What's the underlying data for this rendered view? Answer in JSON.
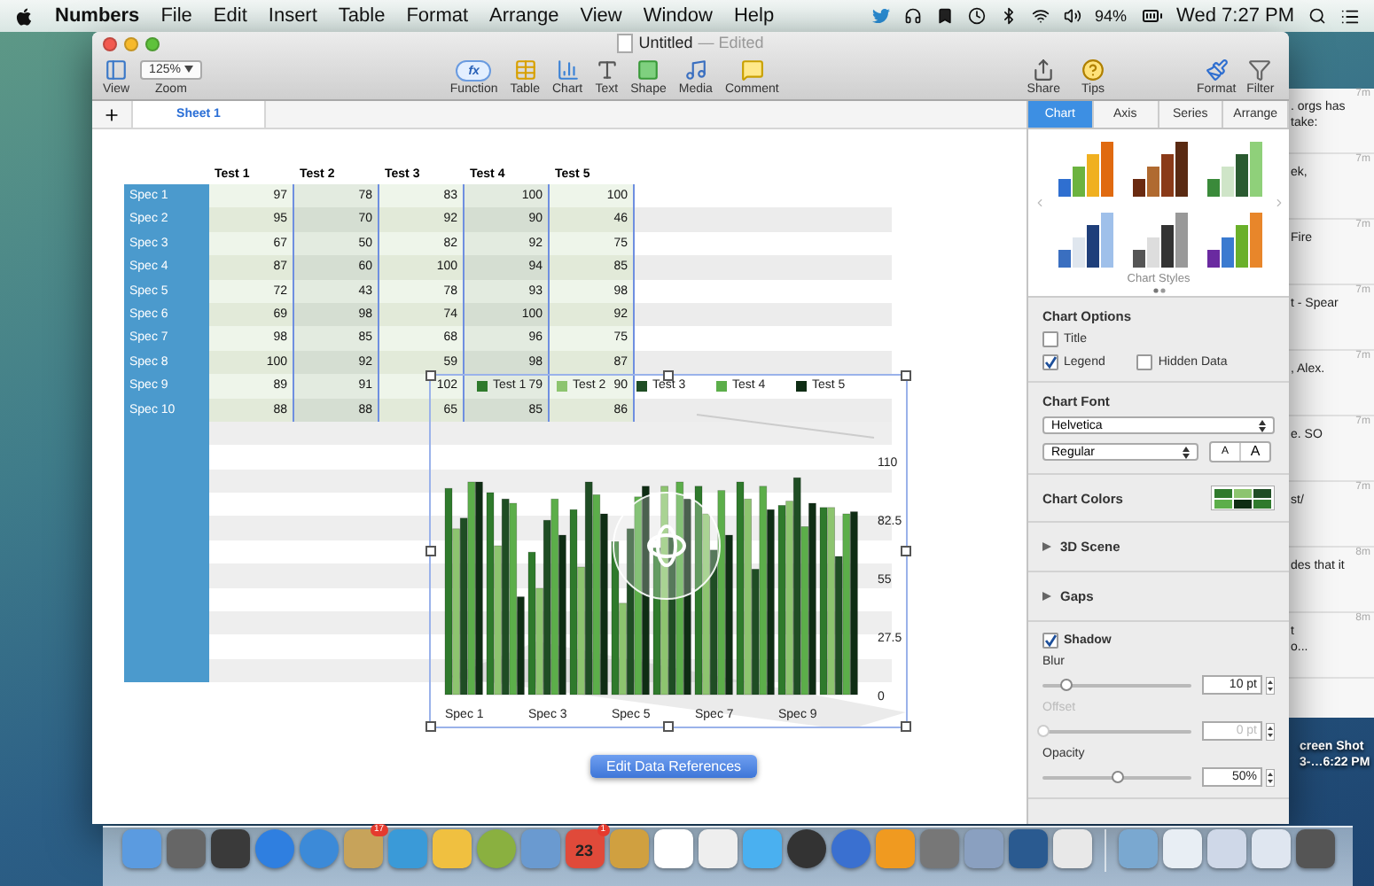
{
  "menu_bar": {
    "app_name": "Numbers",
    "menus": [
      "File",
      "Edit",
      "Insert",
      "Table",
      "Format",
      "Arrange",
      "View",
      "Window",
      "Help"
    ],
    "battery": "94%",
    "clock": "Wed 7:27 PM"
  },
  "window": {
    "title": "Untitled",
    "title_status": "— Edited"
  },
  "toolbar": {
    "view": "View",
    "zoom_value": "125%",
    "zoom_label": "Zoom",
    "insert": [
      {
        "kind": "function",
        "label": "Function",
        "glyph": "fx"
      },
      {
        "kind": "table",
        "label": "Table"
      },
      {
        "kind": "chart",
        "label": "Chart"
      },
      {
        "kind": "text",
        "label": "Text"
      },
      {
        "kind": "shape",
        "label": "Shape"
      },
      {
        "kind": "media",
        "label": "Media"
      },
      {
        "kind": "comment",
        "label": "Comment"
      }
    ],
    "share": [
      {
        "kind": "share",
        "label": "Share"
      },
      {
        "kind": "tips",
        "label": "Tips"
      }
    ],
    "right": [
      {
        "kind": "format",
        "label": "Format"
      },
      {
        "kind": "filter",
        "label": "Filter"
      }
    ]
  },
  "sheets": [
    {
      "label": "Sheet 1",
      "selected": true
    }
  ],
  "table": {
    "columns": [
      "Test 1",
      "Test 2",
      "Test 3",
      "Test 4",
      "Test 5"
    ],
    "rows": [
      {
        "label": "Spec 1",
        "values": [
          "97",
          "78",
          "83",
          "100",
          "100"
        ]
      },
      {
        "label": "Spec 2",
        "values": [
          "95",
          "70",
          "92",
          "90",
          "46"
        ]
      },
      {
        "label": "Spec 3",
        "values": [
          "67",
          "50",
          "82",
          "92",
          "75"
        ]
      },
      {
        "label": "Spec 4",
        "values": [
          "87",
          "60",
          "100",
          "94",
          "85"
        ]
      },
      {
        "label": "Spec 5",
        "values": [
          "72",
          "43",
          "78",
          "93",
          "98"
        ]
      },
      {
        "label": "Spec 6",
        "values": [
          "69",
          "98",
          "74",
          "100",
          "92"
        ]
      },
      {
        "label": "Spec 7",
        "values": [
          "98",
          "85",
          "68",
          "96",
          "75"
        ]
      },
      {
        "label": "Spec 8",
        "values": [
          "100",
          "92",
          "59",
          "98",
          "87"
        ]
      },
      {
        "label": "Spec 9",
        "values": [
          "89",
          "91",
          "102",
          "79",
          "90"
        ]
      },
      {
        "label": "Spec 10",
        "values": [
          "88",
          "88",
          "65",
          "85",
          "86"
        ]
      }
    ]
  },
  "chart": {
    "chart_data": {
      "type": "bar",
      "categories": [
        "Spec 1",
        null,
        "Spec 3",
        null,
        "Spec 5",
        null,
        "Spec 7",
        null,
        "Spec 9",
        null
      ],
      "series": [
        {
          "name": "Test 1",
          "color": "#2f7a2c",
          "values": [
            97,
            95,
            67,
            87,
            72,
            69,
            98,
            100,
            89,
            88
          ]
        },
        {
          "name": "Test 2",
          "color": "#8dc46f",
          "values": [
            78,
            70,
            50,
            60,
            43,
            98,
            85,
            92,
            91,
            88
          ]
        },
        {
          "name": "Test 3",
          "color": "#1f4d24",
          "values": [
            83,
            92,
            82,
            100,
            78,
            74,
            68,
            59,
            102,
            65
          ]
        },
        {
          "name": "Test 4",
          "color": "#5cae4a",
          "values": [
            100,
            90,
            92,
            94,
            93,
            100,
            96,
            98,
            79,
            85
          ]
        },
        {
          "name": "Test 5",
          "color": "#0f2d14",
          "values": [
            100,
            46,
            75,
            85,
            98,
            92,
            75,
            87,
            90,
            86
          ]
        }
      ],
      "ylim": [
        0,
        110
      ],
      "yticks": [
        {
          "value": 0,
          "label": "0"
        },
        {
          "value": 27.5,
          "label": "27.5"
        },
        {
          "value": 55,
          "label": "55"
        },
        {
          "value": 82.5,
          "label": "82.5"
        },
        {
          "value": 110,
          "label": "110"
        }
      ]
    }
  },
  "edit_button": "Edit Data References",
  "inspector": {
    "tabs": [
      {
        "label": "Chart",
        "selected": true
      },
      {
        "label": "Axis",
        "selected": false
      },
      {
        "label": "Series",
        "selected": false
      },
      {
        "label": "Arrange",
        "selected": false
      }
    ],
    "styles_caption": "Chart Styles",
    "chart_options": {
      "heading": "Chart Options",
      "options": [
        {
          "label": "Title",
          "checked": false
        },
        {
          "label": "Legend",
          "checked": true
        },
        {
          "label": "Hidden Data",
          "checked": false
        }
      ]
    },
    "chart_font": {
      "heading": "Chart Font",
      "family": "Helvetica",
      "style": "Regular",
      "size_buttons": [
        "A",
        "A"
      ]
    },
    "chart_colors": {
      "heading": "Chart Colors"
    },
    "disclosures": [
      {
        "label": "3D Scene",
        "expanded": false
      },
      {
        "label": "Gaps",
        "expanded": false
      }
    ],
    "shadow": {
      "label": "Shadow",
      "checked": true,
      "controls": [
        {
          "label": "Blur",
          "level": 0.15,
          "value": "10 pt",
          "disabled": false
        },
        {
          "label": "Offset",
          "level": 0,
          "value": "0 pt",
          "disabled": true
        },
        {
          "label": "Opacity",
          "level": 0.5,
          "value": "50%",
          "disabled": false
        }
      ]
    }
  },
  "background_window": {
    "items": [
      {
        "time": "7m",
        "lines": [
          ". orgs has",
          "take:"
        ]
      },
      {
        "time": "7m",
        "lines": [
          "ek,"
        ]
      },
      {
        "time": "7m",
        "lines": [
          "Fire"
        ]
      },
      {
        "time": "7m",
        "lines": [
          "t - Spear"
        ]
      },
      {
        "time": "7m",
        "lines": [
          ", Alex."
        ]
      },
      {
        "time": "7m",
        "lines": [
          "e. SO"
        ]
      },
      {
        "time": "7m",
        "lines": [
          "st/"
        ]
      },
      {
        "time": "8m",
        "lines": [
          "des that it"
        ]
      },
      {
        "time": "8m",
        "lines": [
          "t",
          "o..."
        ]
      }
    ]
  },
  "desktop_icon": {
    "lines": [
      "creen Shot",
      "3-…6:22 PM"
    ]
  },
  "dock": {
    "mail_badge": "17",
    "calendar_badge": "1",
    "calendar_date": "23"
  }
}
